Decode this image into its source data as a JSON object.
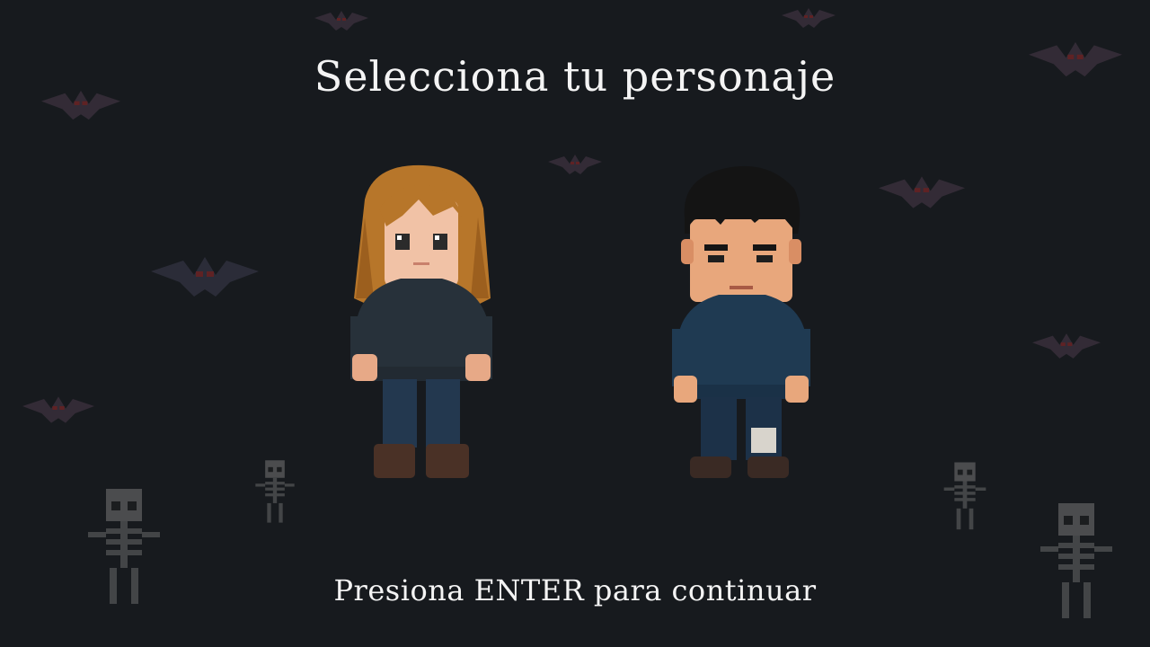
{
  "screen": {
    "title": "Selecciona tu personaje",
    "prompt": "Presiona ENTER para continuar"
  },
  "characters": [
    {
      "id": "female",
      "icon": "female-character-sprite"
    },
    {
      "id": "male",
      "icon": "male-character-sprite"
    }
  ],
  "decorations": {
    "bats": 9,
    "skeletons": 4
  },
  "colors": {
    "background": "#171a1e",
    "text": "#f4f4f4",
    "hoodie": "#1f3a52",
    "hair_female": "#b7762a",
    "hair_male": "#141414"
  }
}
